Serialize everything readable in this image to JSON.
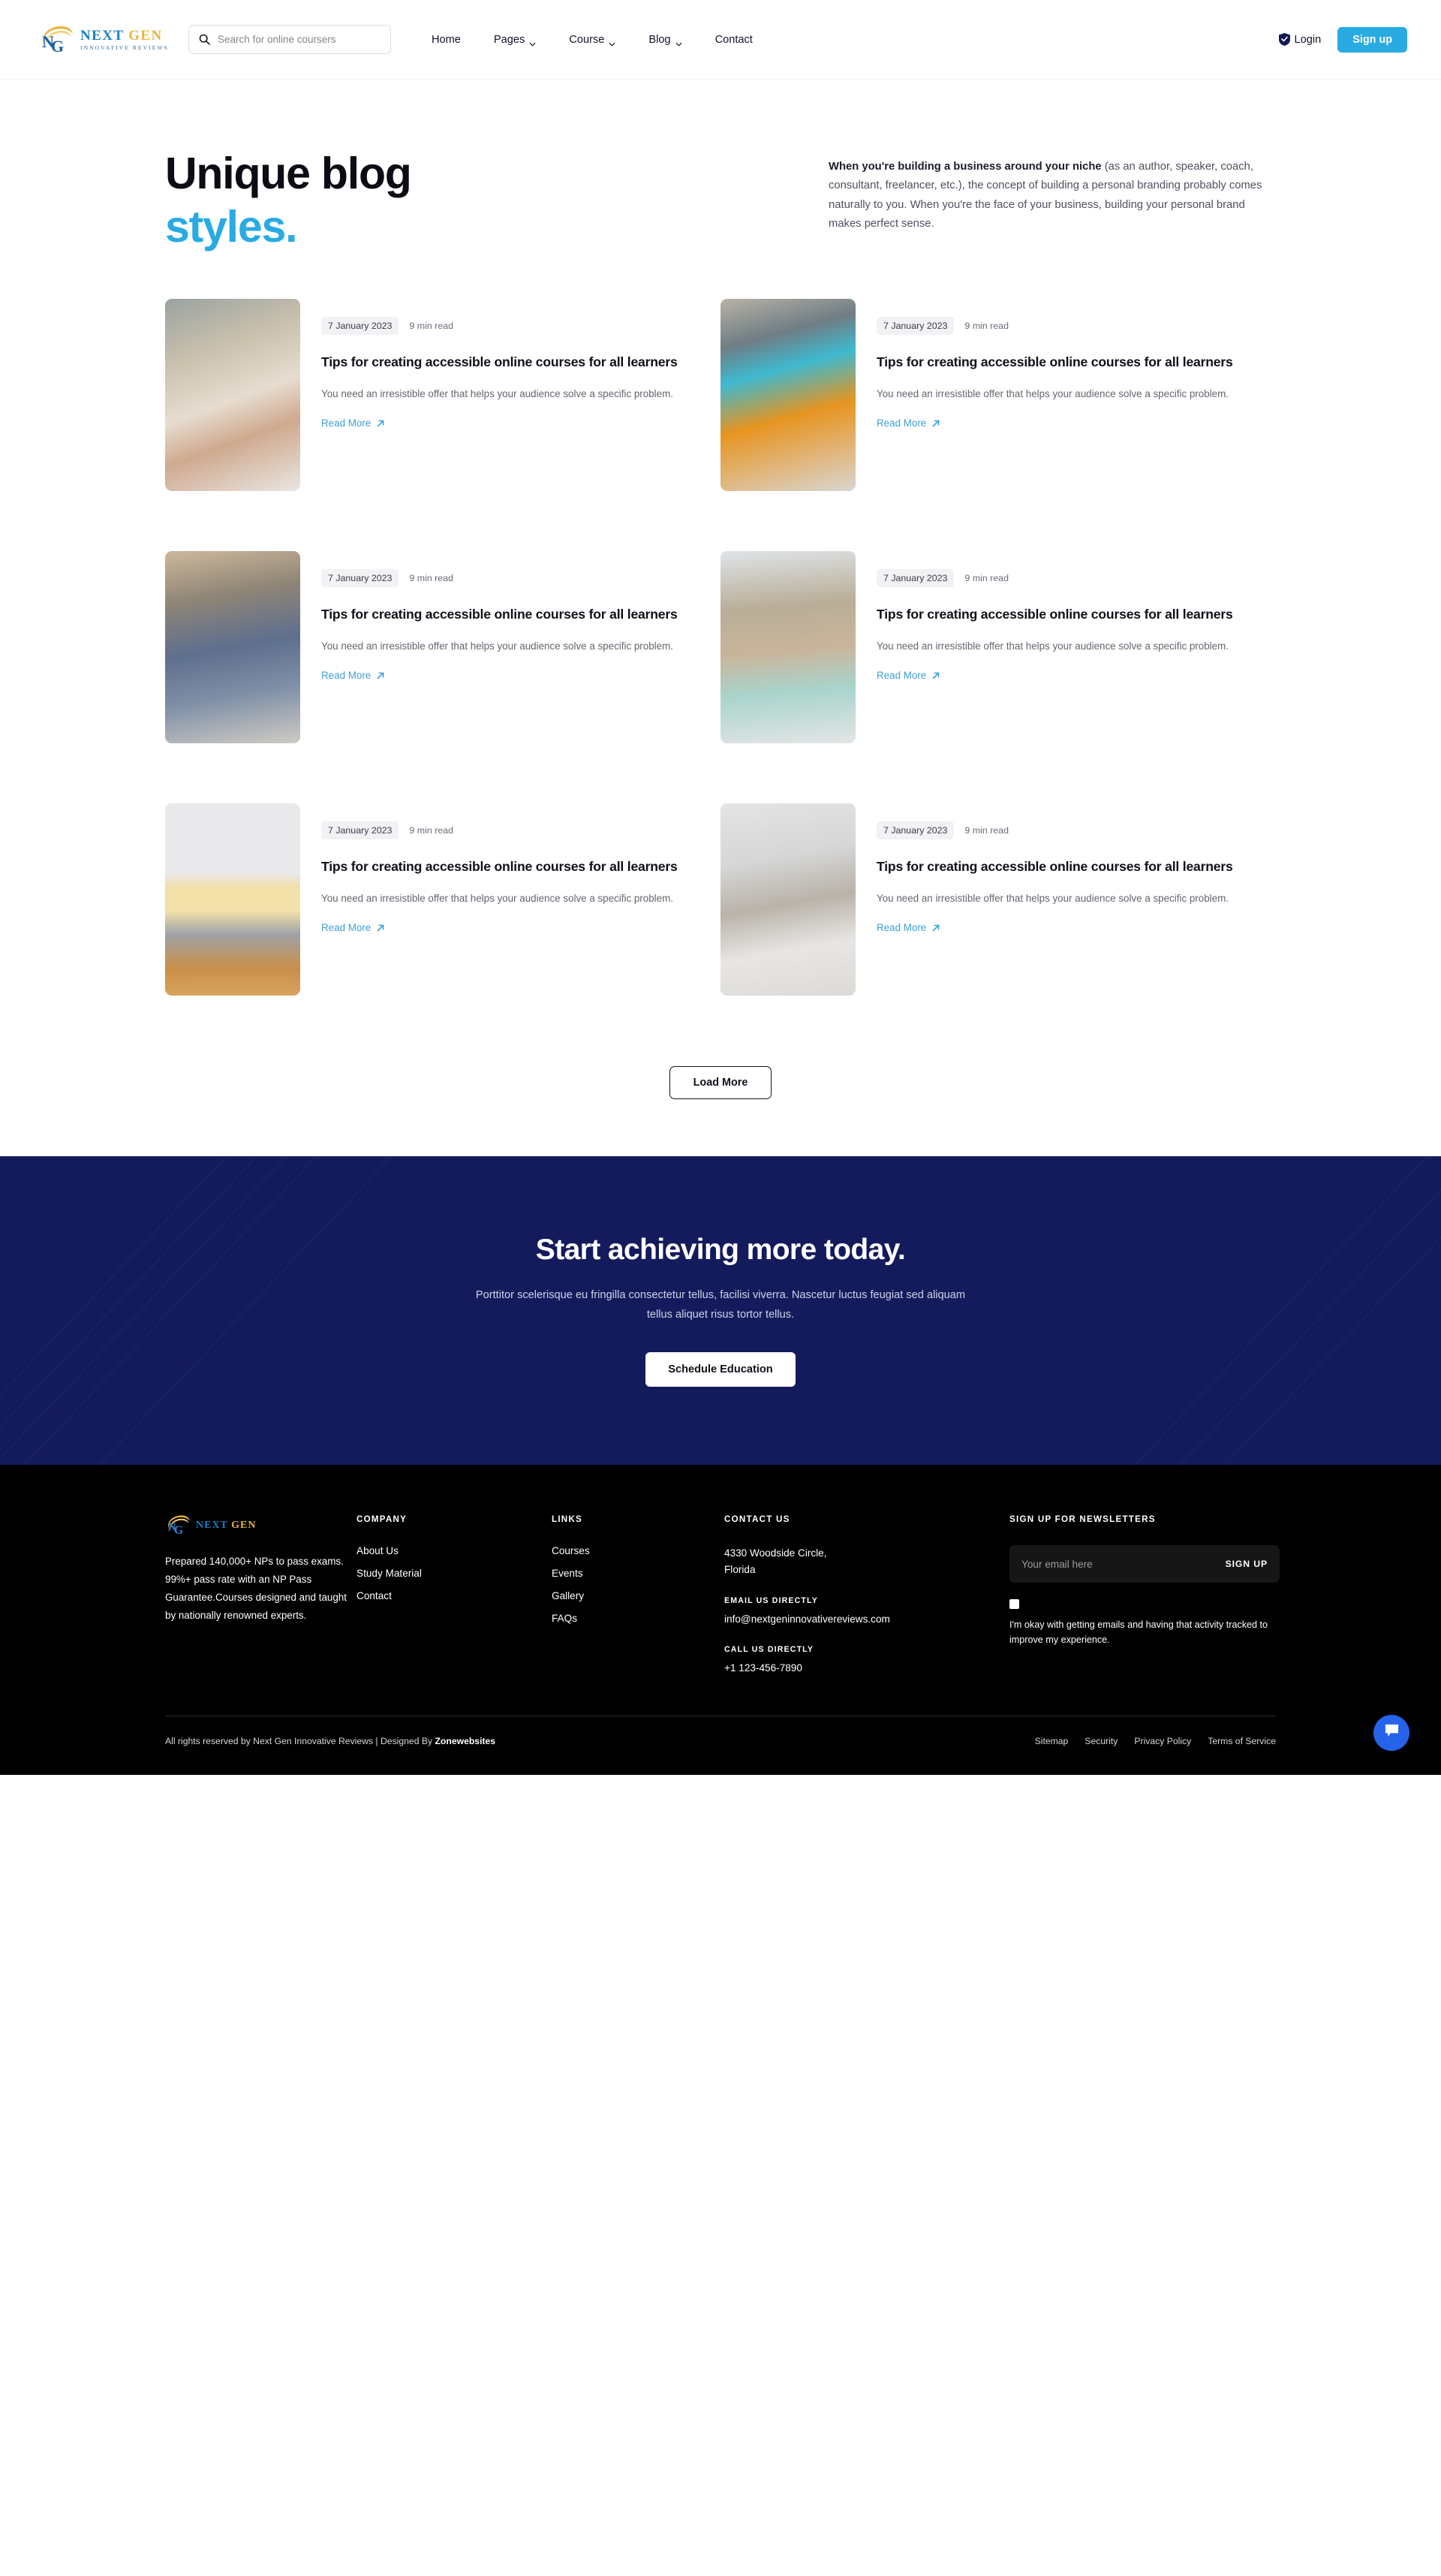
{
  "brand": {
    "name_part1": "NEXT",
    "name_part2": "GEN",
    "tagline": "INNOVATIVE REVIEWS",
    "monogram": "NG",
    "accent_blue": "#29abe2",
    "accent_gold": "#e8b43c",
    "navy": "#141b5c"
  },
  "header": {
    "search": {
      "placeholder": "Search for online coursers",
      "icon": "search-icon"
    },
    "nav": [
      {
        "label": "Home",
        "has_caret": false
      },
      {
        "label": "Pages",
        "has_caret": true
      },
      {
        "label": "Course",
        "has_caret": true
      },
      {
        "label": "Blog",
        "has_caret": true
      },
      {
        "label": "Contact",
        "has_caret": false
      }
    ],
    "login_label": "Login",
    "login_icon": "shield-check-icon",
    "signup_label": "Sign up"
  },
  "hero": {
    "title_line1": "Unique blog",
    "title_line2": "styles.",
    "paragraph_bold": "When you're building a business around your niche",
    "paragraph_rest": " (as an author, speaker, coach, consultant, freelancer, etc.), the concept of building a personal branding probably comes naturally to you. When you're the face of your business, building your personal brand makes perfect sense."
  },
  "blog": {
    "read_more_label": "Read More",
    "load_more_label": "Load More",
    "posts": [
      {
        "date": "7 January 2023",
        "read_time": "9 min read",
        "title": "Tips for creating accessible online courses for all learners",
        "excerpt": "You need an irresistible offer that helps your audience solve a specific problem.",
        "image_alt": "woman-with-white-headphones-writing-at-laptop"
      },
      {
        "date": "7 January 2023",
        "read_time": "9 min read",
        "title": "Tips for creating accessible online courses for all learners",
        "excerpt": "You need an irresistible offer that helps your audience solve a specific problem.",
        "image_alt": "woman-in-orange-shirt-with-teal-headphones-studying"
      },
      {
        "date": "7 January 2023",
        "read_time": "9 min read",
        "title": "Tips for creating accessible online courses for all learners",
        "excerpt": "You need an irresistible offer that helps your audience solve a specific problem.",
        "image_alt": "bearded-man-with-glasses-in-blue-shirt-at-laptop"
      },
      {
        "date": "7 January 2023",
        "read_time": "9 min read",
        "title": "Tips for creating accessible online courses for all learners",
        "excerpt": "You need an irresistible offer that helps your audience solve a specific problem.",
        "image_alt": "man-and-girl-looking-at-laptop-together"
      },
      {
        "date": "7 January 2023",
        "read_time": "9 min read",
        "title": "Tips for creating accessible online courses for all learners",
        "excerpt": "You need an irresistible offer that helps your audience solve a specific problem.",
        "image_alt": "group-of-students-sitting-on-wooden-floor"
      },
      {
        "date": "7 January 2023",
        "read_time": "9 min read",
        "title": "Tips for creating accessible online courses for all learners",
        "excerpt": "You need an irresistible offer that helps your audience solve a specific problem.",
        "image_alt": "woman-in-white-jacket-teaching-with-pen"
      }
    ]
  },
  "cta": {
    "heading": "Start achieving more today.",
    "paragraph": "Porttitor scelerisque eu fringilla consectetur tellus, facilisi viverra. Nascetur luctus feugiat sed aliquam tellus aliquet risus tortor tellus.",
    "button_label": "Schedule Education"
  },
  "footer": {
    "description": "Prepared 140,000+ NPs to pass exams. 99%+ pass rate with an NP Pass Guarantee.Courses designed and taught by nationally renowned experts.",
    "company": {
      "heading": "COMPANY",
      "items": [
        "About Us",
        "Study Material",
        "Contact"
      ]
    },
    "links": {
      "heading": "LINKS",
      "items": [
        "Courses",
        "Events",
        "Gallery",
        "FAQs"
      ]
    },
    "contact": {
      "heading": "CONTACT US",
      "address_line1": "4330 Woodside Circle,",
      "address_line2": "Florida",
      "email_label": "EMAIL US DIRECTLY",
      "email": "info@nextgeninnovativereviews.com",
      "phone_label": "CALL US DIRECTLY",
      "phone": "+1 123-456-7890"
    },
    "newsletter": {
      "heading": "SIGN UP FOR NEWSLETTERS",
      "placeholder": "Your email here",
      "button_label": "SIGN UP",
      "consent": "I'm okay with getting emails and having that activity tracked to improve my experience."
    },
    "copyright_prefix": "All rights reserved by Next Gen Innovative Reviews | Designed By ",
    "copyright_brand": "Zonewebsites",
    "legal": [
      "Sitemap",
      "Security",
      "Privacy Policy",
      "Terms of Service"
    ],
    "chat_icon": "chat-bubble-icon"
  }
}
